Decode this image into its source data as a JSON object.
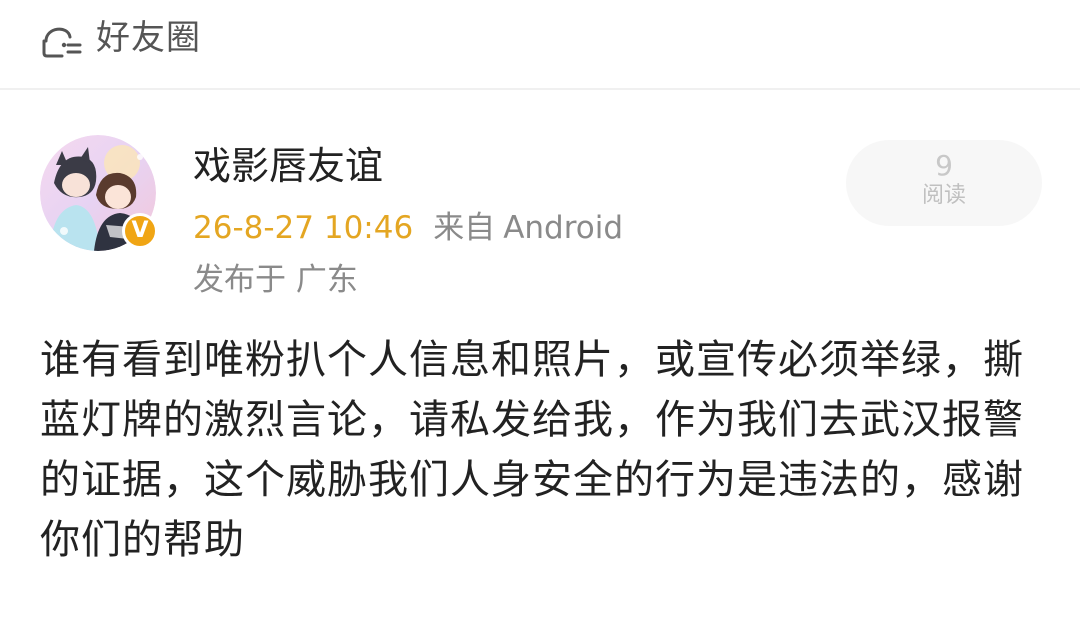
{
  "header": {
    "title": "好友圈",
    "icon": "friends-circle-icon"
  },
  "post": {
    "username": "戏影唇友谊",
    "time": "26-8-27 10:46",
    "source_prefix": "来自",
    "device": "Android",
    "location": "发布于 广东",
    "reads": {
      "count": "9",
      "label": "阅读"
    },
    "badge": "V",
    "colors": {
      "time": "#e4a622",
      "badge": "#f0a514"
    },
    "text": "谁有看到唯粉扒个人信息和照片，或宣传必须举绿，撕蓝灯牌的激烈言论，请私发给我，作为我们去武汉报警的证据，这个威胁我们人身安全的行为是违法的，感谢你们的帮助"
  }
}
